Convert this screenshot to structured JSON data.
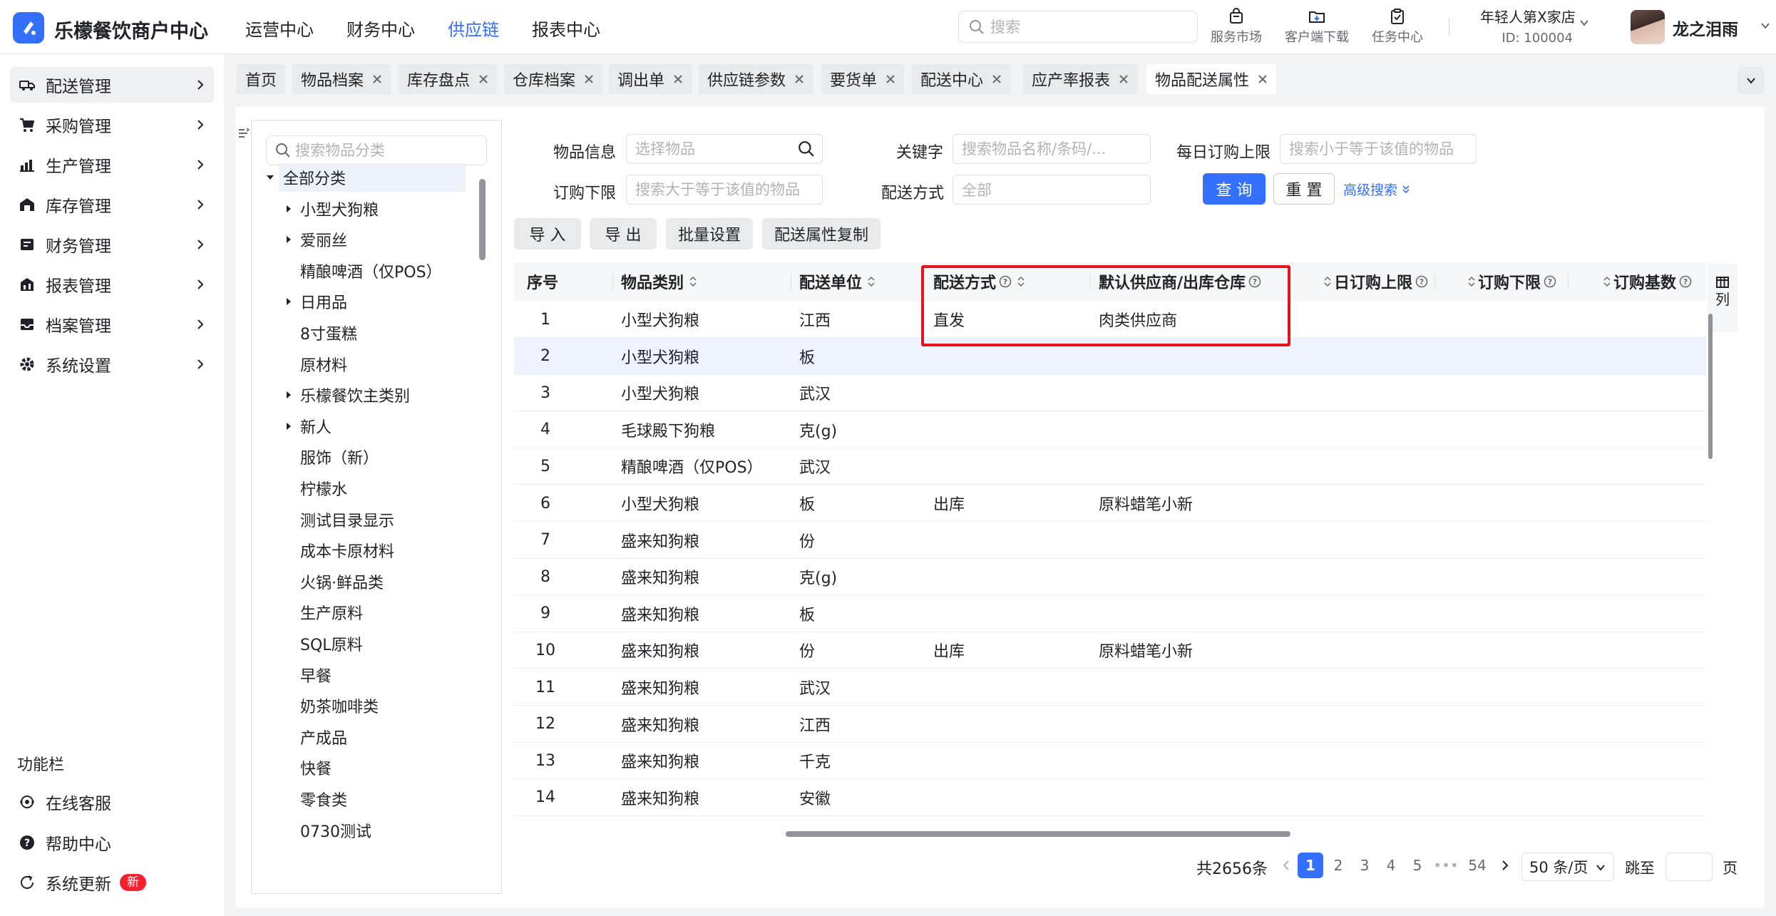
{
  "header": {
    "brand": "乐檬餐饮商户中心",
    "nav": [
      {
        "label": "运营中心",
        "active": false
      },
      {
        "label": "财务中心",
        "active": false
      },
      {
        "label": "供应链",
        "active": true
      },
      {
        "label": "报表中心",
        "active": false
      }
    ],
    "search_placeholder": "搜索",
    "tools": [
      {
        "label": "服务市场",
        "icon": "shop-bag-icon"
      },
      {
        "label": "客户端下载",
        "icon": "folder-download-icon"
      },
      {
        "label": "任务中心",
        "icon": "clipboard-check-icon"
      }
    ],
    "store_name": "年轻人第X家店",
    "store_id": "ID: 100004",
    "username": "龙之泪雨"
  },
  "sidebar": {
    "items": [
      {
        "label": "配送管理",
        "icon": "truck-icon",
        "active": true
      },
      {
        "label": "采购管理",
        "icon": "cart-icon",
        "active": false
      },
      {
        "label": "生产管理",
        "icon": "factory-icon",
        "active": false
      },
      {
        "label": "库存管理",
        "icon": "warehouse-icon",
        "active": false
      },
      {
        "label": "财务管理",
        "icon": "finance-icon",
        "active": false
      },
      {
        "label": "报表管理",
        "icon": "report-icon",
        "active": false
      },
      {
        "label": "档案管理",
        "icon": "archive-icon",
        "active": false
      },
      {
        "label": "系统设置",
        "icon": "gear-icon",
        "active": false
      }
    ],
    "function_title": "功能栏",
    "functions": [
      {
        "label": "在线客服",
        "icon": "headset-icon"
      },
      {
        "label": "帮助中心",
        "icon": "help-icon"
      },
      {
        "label": "系统更新",
        "icon": "refresh-icon",
        "badge": "新"
      }
    ]
  },
  "tabs": [
    {
      "label": "首页",
      "closable": false
    },
    {
      "label": "物品档案",
      "closable": true
    },
    {
      "label": "库存盘点",
      "closable": true
    },
    {
      "label": "仓库档案",
      "closable": true
    },
    {
      "label": "调出单",
      "closable": true
    },
    {
      "label": "供应链参数",
      "closable": true
    },
    {
      "label": "要货单",
      "closable": true
    },
    {
      "label": "配送中心",
      "closable": true
    },
    {
      "label": "应产率报表",
      "closable": true
    },
    {
      "label": "物品配送属性",
      "closable": true,
      "active": true
    }
  ],
  "tree": {
    "search_placeholder": "搜索物品分类",
    "nodes": [
      {
        "label": "全部分类",
        "level": 0,
        "expanded": true,
        "selected": true
      },
      {
        "label": "小型犬狗粮",
        "level": 1,
        "has_children": true
      },
      {
        "label": "爱丽丝",
        "level": 1,
        "has_children": true
      },
      {
        "label": "精酿啤酒（仅POS）",
        "level": 1,
        "has_children": false
      },
      {
        "label": "日用品",
        "level": 1,
        "has_children": true
      },
      {
        "label": "8寸蛋糕",
        "level": 1,
        "has_children": false
      },
      {
        "label": "原材料",
        "level": 1,
        "has_children": false
      },
      {
        "label": "乐檬餐饮主类别",
        "level": 1,
        "has_children": true
      },
      {
        "label": "新人",
        "level": 1,
        "has_children": true
      },
      {
        "label": "服饰（新）",
        "level": 1,
        "has_children": false
      },
      {
        "label": "柠檬水",
        "level": 1,
        "has_children": false
      },
      {
        "label": "测试目录显示",
        "level": 1,
        "has_children": false
      },
      {
        "label": "成本卡原材料",
        "level": 1,
        "has_children": false
      },
      {
        "label": "火锅·鲜品类",
        "level": 1,
        "has_children": false
      },
      {
        "label": "生产原料",
        "level": 1,
        "has_children": false
      },
      {
        "label": "SQL原料",
        "level": 1,
        "has_children": false
      },
      {
        "label": "早餐",
        "level": 1,
        "has_children": false
      },
      {
        "label": "奶茶咖啡类",
        "level": 1,
        "has_children": false
      },
      {
        "label": "产成品",
        "level": 1,
        "has_children": false
      },
      {
        "label": "快餐",
        "level": 1,
        "has_children": false
      },
      {
        "label": "零食类",
        "level": 1,
        "has_children": false
      },
      {
        "label": "0730测试",
        "level": 1,
        "has_children": false
      }
    ]
  },
  "filters": {
    "item_info_label": "物品信息",
    "item_info_placeholder": "选择物品",
    "keyword_label": "关键字",
    "keyword_placeholder": "搜索物品名称/条码/...",
    "daily_limit_label": "每日订购上限",
    "daily_limit_placeholder": "搜索小于等于该值的物品",
    "order_min_label": "订购下限",
    "order_min_placeholder": "搜索大于等于该值的物品",
    "delivery_method_label": "配送方式",
    "delivery_method_value": "全部",
    "query_label": "查 询",
    "reset_label": "重 置",
    "advanced_label": "高级搜索"
  },
  "actions": {
    "import_label": "导 入",
    "export_label": "导 出",
    "batch_label": "批量设置",
    "copy_label": "配送属性复制"
  },
  "table": {
    "columns": [
      "序号",
      "物品类别",
      "配送单位",
      "配送方式",
      "默认供应商/出库仓库",
      "日订购上限",
      "订购下限",
      "订购基数"
    ],
    "column_settings_label": "列",
    "rows": [
      {
        "no": "1",
        "category": "小型犬狗粮",
        "unit": "江西",
        "method": "直发",
        "supplier": "肉类供应商"
      },
      {
        "no": "2",
        "category": "小型犬狗粮",
        "unit": "板",
        "method": "",
        "supplier": ""
      },
      {
        "no": "3",
        "category": "小型犬狗粮",
        "unit": "武汉",
        "method": "",
        "supplier": ""
      },
      {
        "no": "4",
        "category": "毛球殿下狗粮",
        "unit": "克(g)",
        "method": "",
        "supplier": ""
      },
      {
        "no": "5",
        "category": "精酿啤酒（仅POS）",
        "unit": "武汉",
        "method": "",
        "supplier": ""
      },
      {
        "no": "6",
        "category": "小型犬狗粮",
        "unit": "板",
        "method": "出库",
        "supplier": "原料蜡笔小新"
      },
      {
        "no": "7",
        "category": "盛来知狗粮",
        "unit": "份",
        "method": "",
        "supplier": ""
      },
      {
        "no": "8",
        "category": "盛来知狗粮",
        "unit": "克(g)",
        "method": "",
        "supplier": ""
      },
      {
        "no": "9",
        "category": "盛来知狗粮",
        "unit": "板",
        "method": "",
        "supplier": ""
      },
      {
        "no": "10",
        "category": "盛来知狗粮",
        "unit": "份",
        "method": "出库",
        "supplier": "原料蜡笔小新"
      },
      {
        "no": "11",
        "category": "盛来知狗粮",
        "unit": "武汉",
        "method": "",
        "supplier": ""
      },
      {
        "no": "12",
        "category": "盛来知狗粮",
        "unit": "江西",
        "method": "",
        "supplier": ""
      },
      {
        "no": "13",
        "category": "盛来知狗粮",
        "unit": "千克",
        "method": "",
        "supplier": ""
      },
      {
        "no": "14",
        "category": "盛来知狗粮",
        "unit": "安徽",
        "method": "",
        "supplier": ""
      }
    ]
  },
  "pagination": {
    "total": "共2656条",
    "pages": [
      "1",
      "2",
      "3",
      "4",
      "5",
      "•••",
      "54"
    ],
    "current": "1",
    "page_size": "50 条/页",
    "jump_label": "跳至",
    "page_label": "页"
  },
  "colors": {
    "accent": "#3370ff",
    "highlight_border": "#e5141e",
    "badge": "#f5222d"
  }
}
